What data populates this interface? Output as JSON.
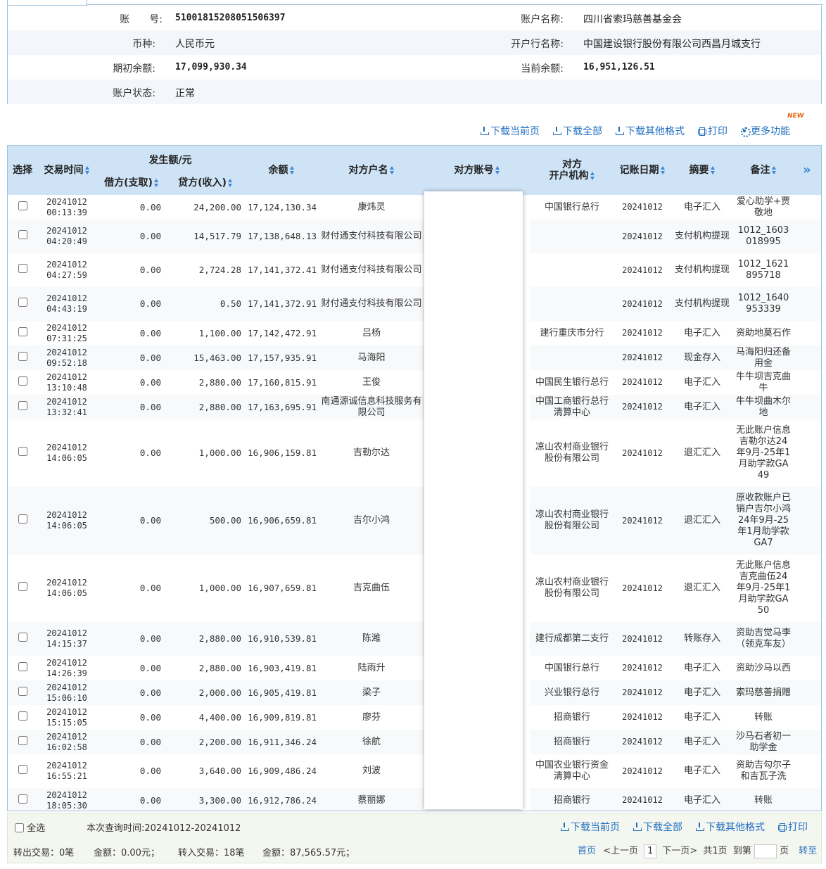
{
  "account": {
    "no_label": "账　　号:",
    "no_value": "51001815208051506397",
    "name_label": "账户名称:",
    "name_value": "四川省索玛慈善基金会",
    "currency_label": "币种:",
    "currency_value": "人民币元",
    "bank_label": "开户行名称:",
    "bank_value": "中国建设银行股份有限公司西昌月城支行",
    "opening_label": "期初余额:",
    "opening_value": "17,099,930.34",
    "current_label": "当前余额:",
    "current_value": "16,951,126.51",
    "status_label": "账户状态:",
    "status_value": "正常"
  },
  "toolbar": {
    "download_page": "下载当前页",
    "download_all": "下载全部",
    "download_other": "下载其他格式",
    "print": "打印",
    "more": "更多功能",
    "new_badge": "NEW"
  },
  "columns": {
    "select": "选择",
    "time": "交易时间",
    "amount_group": "发生额/元",
    "debit": "借方(支取)",
    "credit": "贷方(收入)",
    "balance": "余额",
    "counter_name": "对方户名",
    "counter_account": "对方账号",
    "counter_bank_line1": "对方",
    "counter_bank_line2": "开户机构",
    "post_date": "记账日期",
    "summary": "摘要",
    "remark": "备注",
    "more_cols": "»"
  },
  "rows": [
    {
      "date": "20241012",
      "time": "00:13:39",
      "debit": "0.00",
      "credit": "24,200.00",
      "balance": "17,124,130.34",
      "name": "康炜灵",
      "bank": "中国银行总行",
      "post": "20241012",
      "summary": "电子汇入",
      "remark": "爱心助学+贾敬地"
    },
    {
      "date": "20241012",
      "time": "04:20:49",
      "debit": "0.00",
      "credit": "14,517.79",
      "balance": "17,138,648.13",
      "name": "财付通支付科技有限公司",
      "bank": "",
      "post": "20241012",
      "summary": "支付机构提现",
      "remark": "1012_1603018995"
    },
    {
      "date": "20241012",
      "time": "04:27:59",
      "debit": "0.00",
      "credit": "2,724.28",
      "balance": "17,141,372.41",
      "name": "财付通支付科技有限公司",
      "bank": "",
      "post": "20241012",
      "summary": "支付机构提现",
      "remark": "1012_1621895718"
    },
    {
      "date": "20241012",
      "time": "04:43:19",
      "debit": "0.00",
      "credit": "0.50",
      "balance": "17,141,372.91",
      "name": "财付通支付科技有限公司",
      "bank": "",
      "post": "20241012",
      "summary": "支付机构提现",
      "remark": "1012_1640953339"
    },
    {
      "date": "20241012",
      "time": "07:31:25",
      "debit": "0.00",
      "credit": "1,100.00",
      "balance": "17,142,472.91",
      "name": "吕杨",
      "bank": "建行重庆市分行",
      "post": "20241012",
      "summary": "电子汇入",
      "remark": "资助地莫石作"
    },
    {
      "date": "20241012",
      "time": "09:52:18",
      "debit": "0.00",
      "credit": "15,463.00",
      "balance": "17,157,935.91",
      "name": "马海阳",
      "bank": "",
      "post": "20241012",
      "summary": "现金存入",
      "remark": "马海阳归还备用金"
    },
    {
      "date": "20241012",
      "time": "13:10:48",
      "debit": "0.00",
      "credit": "2,880.00",
      "balance": "17,160,815.91",
      "name": "王俊",
      "bank": "中国民生银行总行",
      "post": "20241012",
      "summary": "电子汇入",
      "remark": "牛牛坝吉克曲牛"
    },
    {
      "date": "20241012",
      "time": "13:32:41",
      "debit": "0.00",
      "credit": "2,880.00",
      "balance": "17,163,695.91",
      "name": "南通源诚信息科技服务有限公司",
      "bank": "中国工商银行总行清算中心",
      "post": "20241012",
      "summary": "电子汇入",
      "remark": "牛牛坝曲木尔地"
    },
    {
      "date": "20241012",
      "time": "14:06:05",
      "debit": "0.00",
      "credit": "1,000.00",
      "balance": "16,906,159.81",
      "name": "吉勒尔达",
      "bank": "凉山农村商业银行股份有限公司",
      "post": "20241012",
      "summary": "退汇汇入",
      "remark": "无此账户信息吉勒尔达24年9月-25年1月助学款GA49"
    },
    {
      "date": "20241012",
      "time": "14:06:05",
      "debit": "0.00",
      "credit": "500.00",
      "balance": "16,906,659.81",
      "name": "吉尔小鸿",
      "bank": "凉山农村商业银行股份有限公司",
      "post": "20241012",
      "summary": "退汇汇入",
      "remark": "原收款账户已销户吉尔小鸿24年9月-25年1月助学款GA7"
    },
    {
      "date": "20241012",
      "time": "14:06:05",
      "debit": "0.00",
      "credit": "1,000.00",
      "balance": "16,907,659.81",
      "name": "吉克曲伍",
      "bank": "凉山农村商业银行股份有限公司",
      "post": "20241012",
      "summary": "退汇汇入",
      "remark": "无此账户信息吉克曲伍24年9月-25年1月助学款GA50"
    },
    {
      "date": "20241012",
      "time": "14:15:37",
      "debit": "0.00",
      "credit": "2,880.00",
      "balance": "16,910,539.81",
      "name": "陈潍",
      "bank": "建行成都第二支行",
      "post": "20241012",
      "summary": "转账存入",
      "remark": "资助吉觉马李（领克车友）"
    },
    {
      "date": "20241012",
      "time": "14:26:39",
      "debit": "0.00",
      "credit": "2,880.00",
      "balance": "16,903,419.81",
      "name": "陆雨升",
      "bank": "中国银行总行",
      "post": "20241012",
      "summary": "电子汇入",
      "remark": "资助沙马以西"
    },
    {
      "date": "20241012",
      "time": "15:06:10",
      "debit": "0.00",
      "credit": "2,000.00",
      "balance": "16,905,419.81",
      "name": "梁子",
      "bank": "兴业银行总行",
      "post": "20241012",
      "summary": "电子汇入",
      "remark": "索玛慈善捐赠"
    },
    {
      "date": "20241012",
      "time": "15:15:05",
      "debit": "0.00",
      "credit": "4,400.00",
      "balance": "16,909,819.81",
      "name": "廖芬",
      "bank": "招商银行",
      "post": "20241012",
      "summary": "电子汇入",
      "remark": "转账"
    },
    {
      "date": "20241012",
      "time": "16:02:58",
      "debit": "0.00",
      "credit": "2,200.00",
      "balance": "16,911,346.24",
      "name": "徐航",
      "bank": "招商银行",
      "post": "20241012",
      "summary": "电子汇入",
      "remark": "沙马石者初一助学金"
    },
    {
      "date": "20241012",
      "time": "16:55:21",
      "debit": "0.00",
      "credit": "3,640.00",
      "balance": "16,909,486.24",
      "name": "刘波",
      "bank": "中国农业银行资金清算中心",
      "post": "20241012",
      "summary": "电子汇入",
      "remark": "资助吉勾尔子和吉瓦子洗"
    },
    {
      "date": "20241012",
      "time": "18:05:30",
      "debit": "0.00",
      "credit": "3,300.00",
      "balance": "16,912,786.24",
      "name": "蔡丽娜",
      "bank": "招商银行",
      "post": "20241012",
      "summary": "电子汇入",
      "remark": "转账"
    }
  ],
  "footer": {
    "select_all": "全选",
    "query_time": "本次查询时间:20241012-20241012",
    "download_page": "下载当前页",
    "download_all": "下载全部",
    "download_other": "下载其他格式",
    "print": "打印",
    "out_tx": "转出交易：0笔",
    "out_amount": "金额：0.00元；",
    "in_tx": "转入交易：18笔",
    "in_amount": "金额：87,565.57元；",
    "first": "首页",
    "prev": "<上一页",
    "page_no": "1",
    "next": "下一页>",
    "total": "共1页",
    "goto_label": "到第",
    "page_suffix": "页",
    "goto": "转至"
  }
}
